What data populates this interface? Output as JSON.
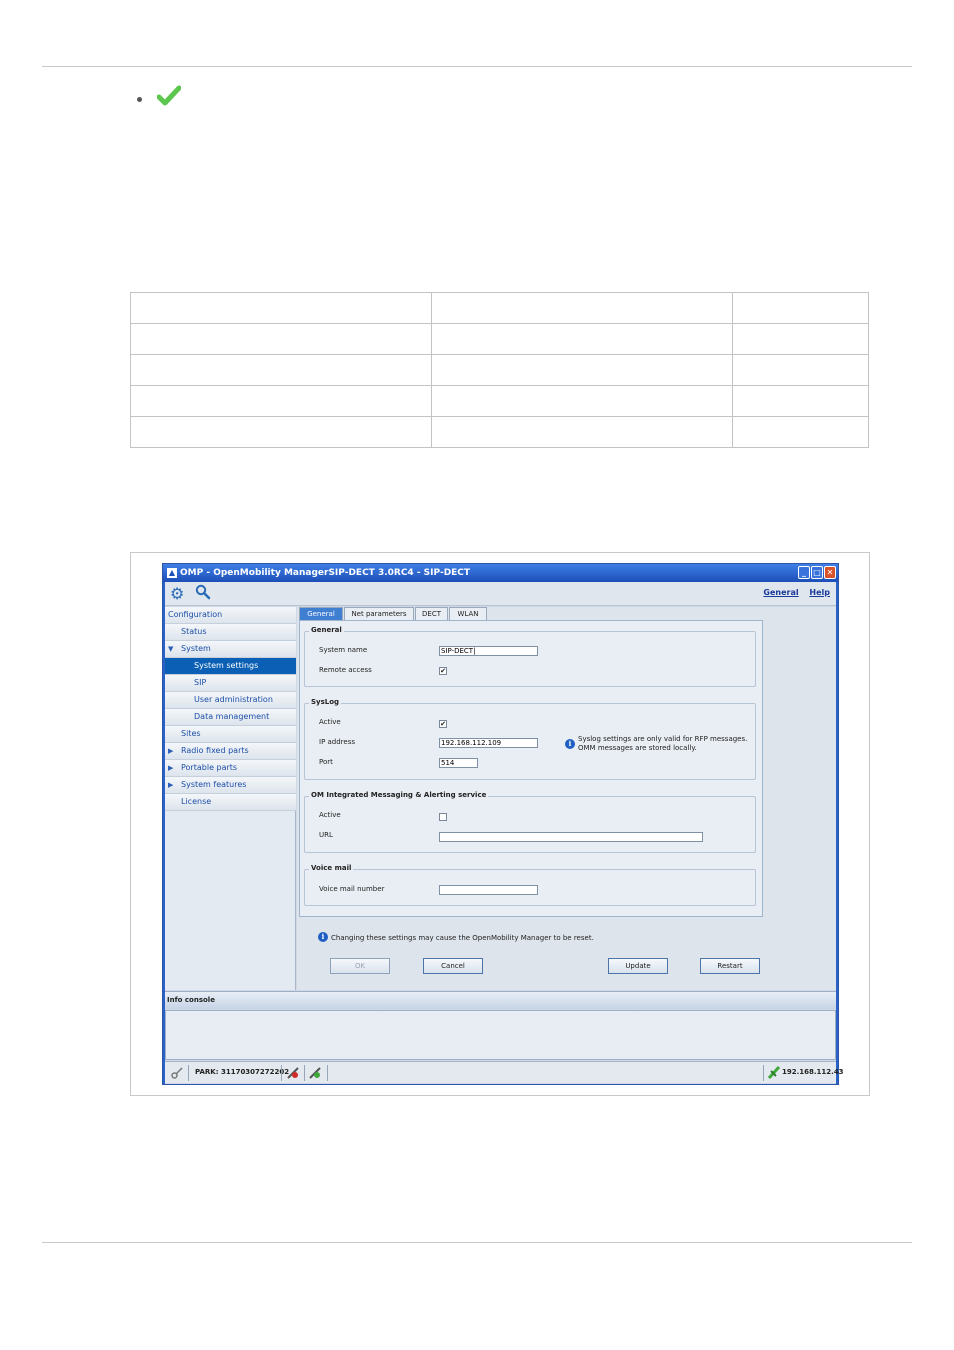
{
  "bullet": {
    "icon": "green-checkmark-icon"
  },
  "window": {
    "title": "OMP - OpenMobility ManagerSIP-DECT 3.0RC4 - SIP-DECT",
    "controls": [
      "_",
      "□",
      "✕"
    ],
    "links": {
      "general": "General",
      "help": "Help"
    }
  },
  "sidebar": {
    "items": [
      {
        "label": "Configuration"
      },
      {
        "label": "Status"
      },
      {
        "label": "System"
      },
      {
        "label": "System settings"
      },
      {
        "label": "SIP"
      },
      {
        "label": "User administration"
      },
      {
        "label": "Data management"
      },
      {
        "label": "Sites"
      },
      {
        "label": "Radio fixed parts"
      },
      {
        "label": "Portable parts"
      },
      {
        "label": "System features"
      },
      {
        "label": "License"
      }
    ]
  },
  "tabs": [
    "General",
    "Net parameters",
    "DECT",
    "WLAN"
  ],
  "general": {
    "title": "General",
    "system_name_label": "System name",
    "system_name_value": "SIP-DECT",
    "remote_access_label": "Remote access",
    "remote_access_checked": "✔"
  },
  "syslog": {
    "title": "SysLog",
    "active_label": "Active",
    "active_checked": "✔",
    "ip_label": "IP address",
    "ip_value": "192.168.112.109",
    "port_label": "Port",
    "port_value": "514",
    "info_line1": "Syslog settings are only valid for RFP messages.",
    "info_line2": "OMM messages are stored locally."
  },
  "messaging": {
    "title": "OM Integrated Messaging & Alerting service",
    "active_label": "Active",
    "url_label": "URL",
    "url_value": ""
  },
  "voicemail": {
    "title": "Voice mail",
    "number_label": "Voice mail number",
    "number_value": ""
  },
  "warning": "Changing these settings may cause the OpenMobility Manager to be reset.",
  "buttons": {
    "ok": "OK",
    "cancel": "Cancel",
    "update": "Update",
    "restart": "Restart"
  },
  "console": {
    "title": "Info console"
  },
  "statusbar": {
    "park": "PARK: 31170307272202",
    "ip": "192.168.112.43"
  },
  "colors": {
    "title_bar": "#2a62c8",
    "selected_nav": "#0b5fb4",
    "active_tab": "#3f7fd2",
    "check_green": "#5cc64f"
  }
}
